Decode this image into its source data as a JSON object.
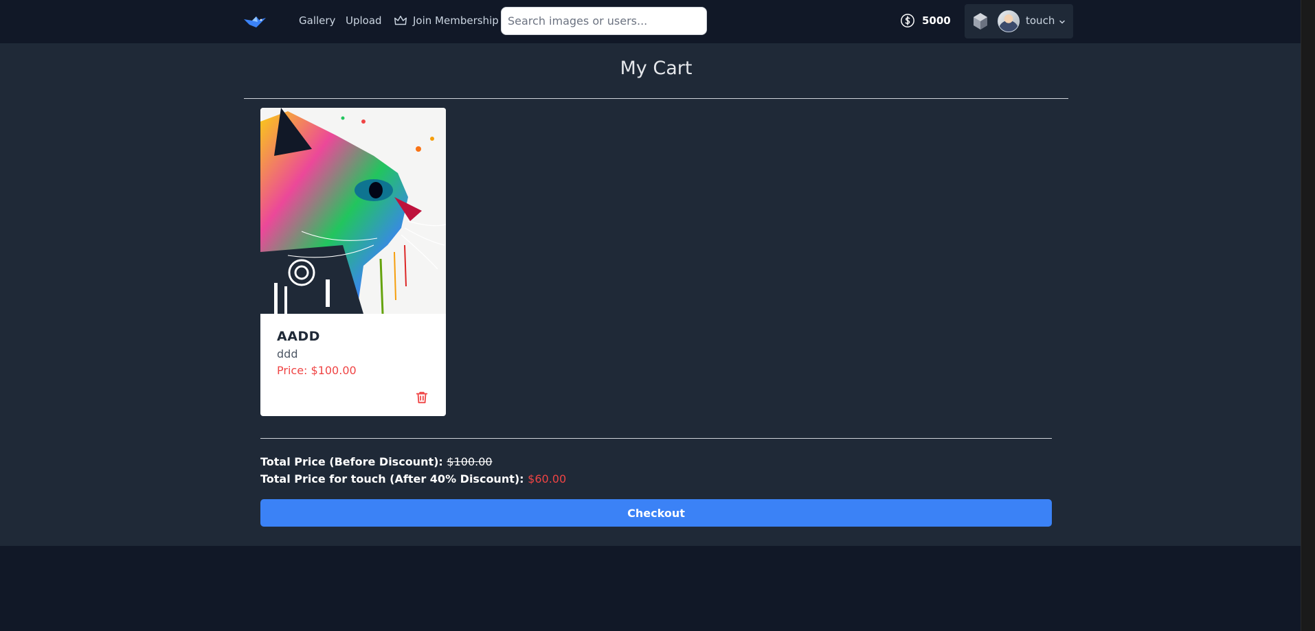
{
  "nav": {
    "logo_icon": "bird-logo-icon",
    "links": [
      "Gallery",
      "Upload"
    ],
    "membership": {
      "label": "Join Membership",
      "icon": "crown-icon"
    },
    "search_placeholder": "Search images or users..."
  },
  "account": {
    "coins_icon": "dollar-coin-icon",
    "coins": "5000",
    "gem_icon": "gem-icon",
    "username": "touch",
    "dropdown_icon": "chevron-down-icon"
  },
  "cart": {
    "title": "My Cart",
    "items": [
      {
        "title": "AADD",
        "description": "ddd",
        "price": "Price: $100.00",
        "image": "colorful-cat-artwork",
        "delete_icon": "trash-icon"
      }
    ],
    "total_before_label": "Total Price (Before Discount):",
    "total_before_value": "$100.00",
    "total_after_label": "Total Price for touch (After 40% Discount):",
    "total_after_value": "$60.00",
    "checkout_label": "Checkout"
  },
  "colors": {
    "accent": "#3b82f6",
    "price_red": "#ef4444",
    "nav_bg": "#111827",
    "page_bg": "#1f2937"
  }
}
